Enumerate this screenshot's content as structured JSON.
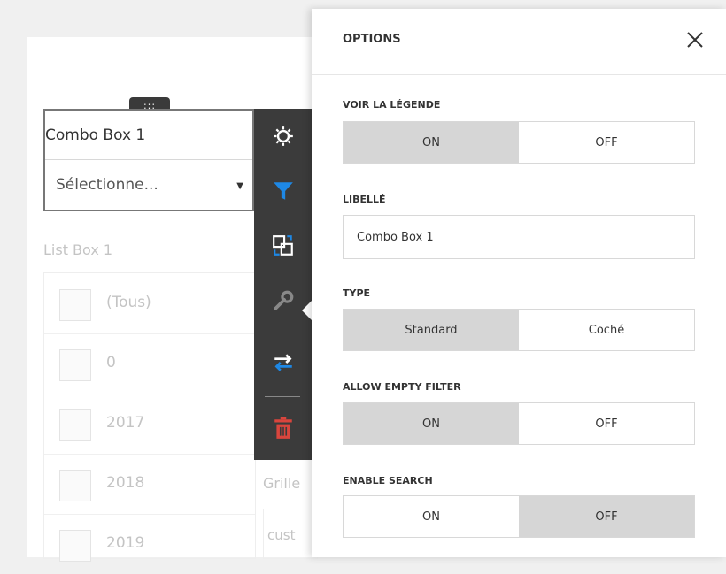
{
  "combo_box": {
    "handle": ":::",
    "title": "Combo Box 1",
    "select_value": "Sélectionne...",
    "caret": "▼"
  },
  "list_box": {
    "title": "List Box 1",
    "items": [
      "(Tous)",
      "0",
      "2017",
      "2018",
      "2019"
    ]
  },
  "grid": {
    "title": "Grille",
    "cell": "cust"
  },
  "toolbar": {
    "buttons": [
      "gear-icon",
      "filter-icon",
      "convert-icon",
      "wrench-icon",
      "interactivity-icon",
      "delete-icon"
    ],
    "colors": {
      "gear": "#ffffff",
      "filter": "#1e88e5",
      "convert": "#ffffff",
      "wrench": "#888888",
      "swap": "#ffffff",
      "delete": "#d9453d"
    }
  },
  "options": {
    "title": "OPTIONS",
    "close_label": "✕",
    "show_legend": {
      "label": "VOIR LA LÉGENDE",
      "on": "ON",
      "off": "OFF",
      "selected": "on"
    },
    "caption": {
      "label": "LIBELLÉ",
      "value": "Combo Box 1"
    },
    "type": {
      "label": "TYPE",
      "standard": "Standard",
      "checked": "Coché",
      "selected": "standard"
    },
    "allow_empty_filter": {
      "label": "ALLOW EMPTY FILTER",
      "on": "ON",
      "off": "OFF",
      "selected": "on"
    },
    "enable_search": {
      "label": "ENABLE SEARCH",
      "on": "ON",
      "off": "OFF",
      "selected": "off"
    }
  }
}
